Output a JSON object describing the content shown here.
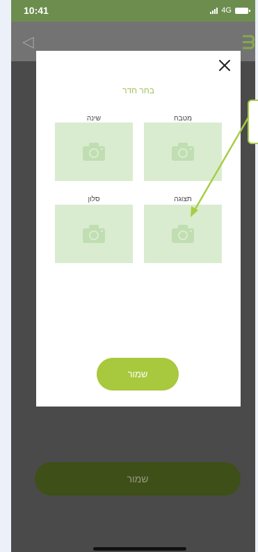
{
  "status_bar": {
    "time": "10:41",
    "network": "4G",
    "location_icon": "location-arrow-icon"
  },
  "header": {
    "back_icon": "back-triangle-icon",
    "menu_icon": "menu-icon"
  },
  "modal": {
    "title": "בחר חדר",
    "close_icon": "close-icon",
    "rooms": [
      {
        "label": "מטבח",
        "icon": "camera-icon"
      },
      {
        "label": "שינה",
        "icon": "camera-icon"
      },
      {
        "label": "תצוגה",
        "icon": "camera-icon"
      },
      {
        "label": "סלון",
        "icon": "camera-icon"
      }
    ],
    "save_label": "שמור"
  },
  "page": {
    "save_label": "שמור"
  },
  "colors": {
    "accent_green": "#a8c83d",
    "tile_green": "#d9ecd0",
    "status_bar": "#6d8d4f"
  }
}
